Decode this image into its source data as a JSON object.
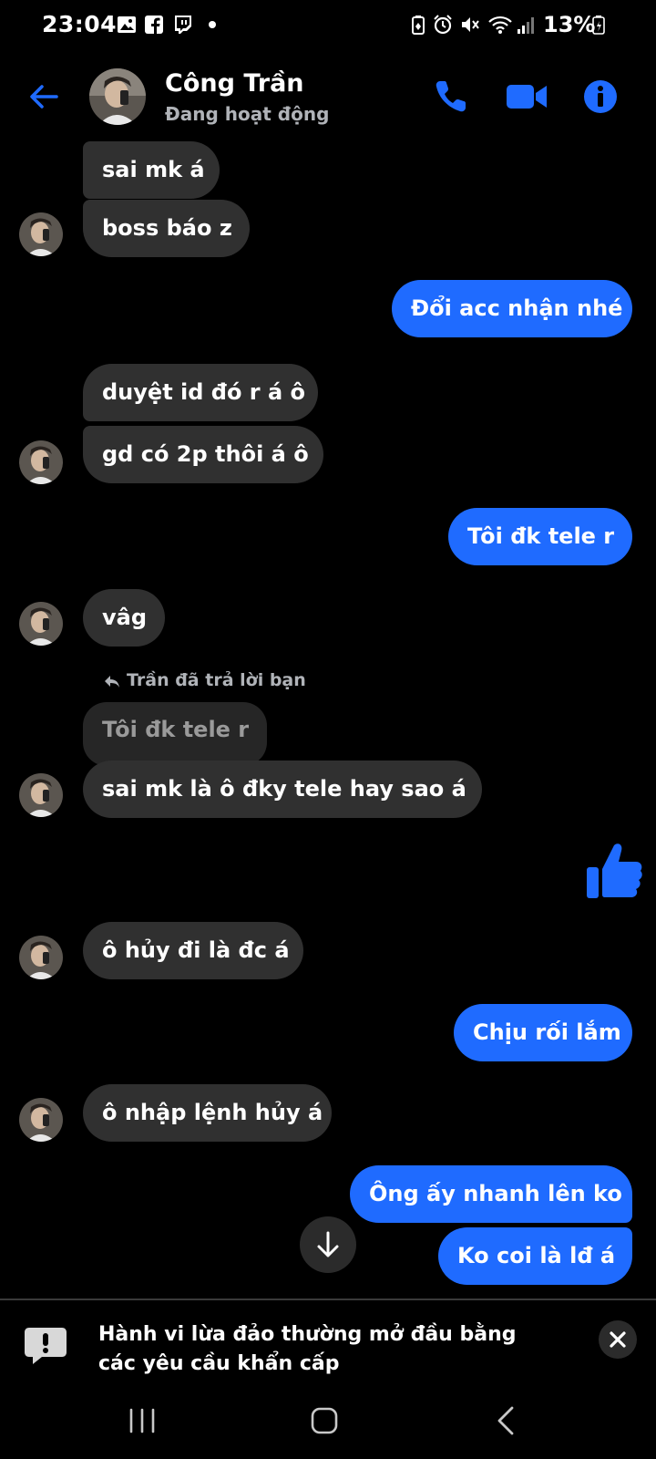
{
  "status_bar": {
    "time": "23:04",
    "battery": "13%",
    "left_icons": [
      "gallery-icon",
      "facebook-icon",
      "twitch-icon",
      "dot-icon"
    ],
    "right_icons": [
      "battery-saver-icon",
      "alarm-icon",
      "mute-icon",
      "wifi-icon",
      "signal-icon",
      "battery-icon"
    ]
  },
  "header": {
    "name": "Công Trần",
    "status": "Đang hoạt động"
  },
  "messages": {
    "m1": "sai mk á",
    "m2": "boss báo z",
    "m3": "Đổi acc nhận nhé",
    "m4": "duyệt id đó r á ô",
    "m5": "gd có 2p thôi á ô",
    "m6": "Tôi đk tele r",
    "m7": "vâg",
    "reply_label": "Trần đã trả lời bạn",
    "quoted": "Tôi đk tele r",
    "m8": "sai mk là ô đky tele hay sao á",
    "like": "thumbs-up",
    "m9": "ô hủy đi là đc á",
    "m10": "Chịu rối lắm",
    "m11": "ô nhập lệnh hủy á",
    "m12": "Ông ấy nhanh lên ko",
    "m13": "Ko coi là lđ á"
  },
  "notice": {
    "text": "Hành vi lừa đảo thường mở đầu bằng các yêu cầu khẩn cấp"
  },
  "colors": {
    "accent": "#1f6bff",
    "incoming_bubble": "#303030",
    "background": "#000000"
  }
}
